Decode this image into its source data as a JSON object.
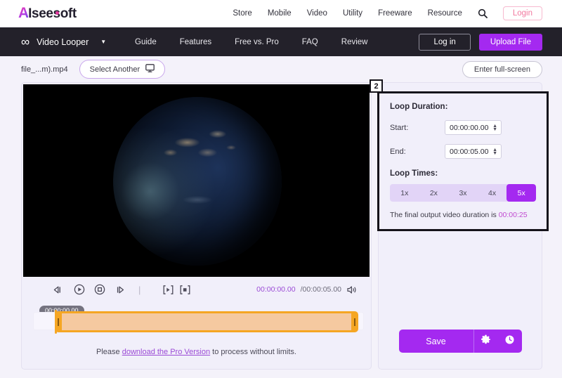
{
  "topbar": {
    "logo_mark": "A",
    "logo_text": "Iseesoft",
    "nav": [
      {
        "label": "Store"
      },
      {
        "label": "Mobile"
      },
      {
        "label": "Video"
      },
      {
        "label": "Utility"
      },
      {
        "label": "Freeware"
      },
      {
        "label": "Resource"
      }
    ],
    "search_icon": "search-icon",
    "login_label": "Login"
  },
  "darknav": {
    "loop_icon": "infinity-icon",
    "brand": "Video Looper",
    "caret": "▼",
    "links": [
      {
        "label": "Guide"
      },
      {
        "label": "Features"
      },
      {
        "label": "Free vs. Pro"
      },
      {
        "label": "FAQ"
      },
      {
        "label": "Review"
      }
    ],
    "login_label": "Log in",
    "upload_label": "Upload File"
  },
  "filerow": {
    "filename": "file_...m).mp4",
    "select_another": "Select Another",
    "monitor_icon": "monitor-icon",
    "fullscreen_label": "Enter full-screen"
  },
  "player": {
    "controls": [
      {
        "name": "rewind-icon"
      },
      {
        "name": "play-icon"
      },
      {
        "name": "stop-icon"
      },
      {
        "name": "forward-icon"
      },
      {
        "name": "divider"
      },
      {
        "name": "set-start-icon"
      },
      {
        "name": "set-end-icon"
      }
    ],
    "current_time": "00:00:00.00",
    "total_time": "/00:00:05.00",
    "volume_icon": "volume-icon",
    "timeline_tooltip": "00:00:00.00",
    "hint_prefix": "Please ",
    "hint_link": "download the Pro Version",
    "hint_suffix": " to process without limits."
  },
  "settings": {
    "badge": "2",
    "loop_duration_title": "Loop Duration:",
    "start_label": "Start:",
    "start_value": "00:00:00.00",
    "end_label": "End:",
    "end_value": "00:00:05.00",
    "loop_times_title": "Loop Times:",
    "loop_options": [
      {
        "label": "1x",
        "active": false
      },
      {
        "label": "2x",
        "active": false
      },
      {
        "label": "3x",
        "active": false
      },
      {
        "label": "4x",
        "active": false
      },
      {
        "label": "5x",
        "active": true
      }
    ],
    "final_note_prefix": "The final output video duration is ",
    "final_note_value": "00:00:25",
    "save_label": "Save",
    "gear_icon": "gear-icon",
    "clock_icon": "clock-icon"
  },
  "colors": {
    "accent": "#a429f0",
    "nav_dark": "#23212a",
    "panel_bg": "#f1effa",
    "trim_orange": "#f5a623",
    "link_purple": "#9b4bd6"
  }
}
